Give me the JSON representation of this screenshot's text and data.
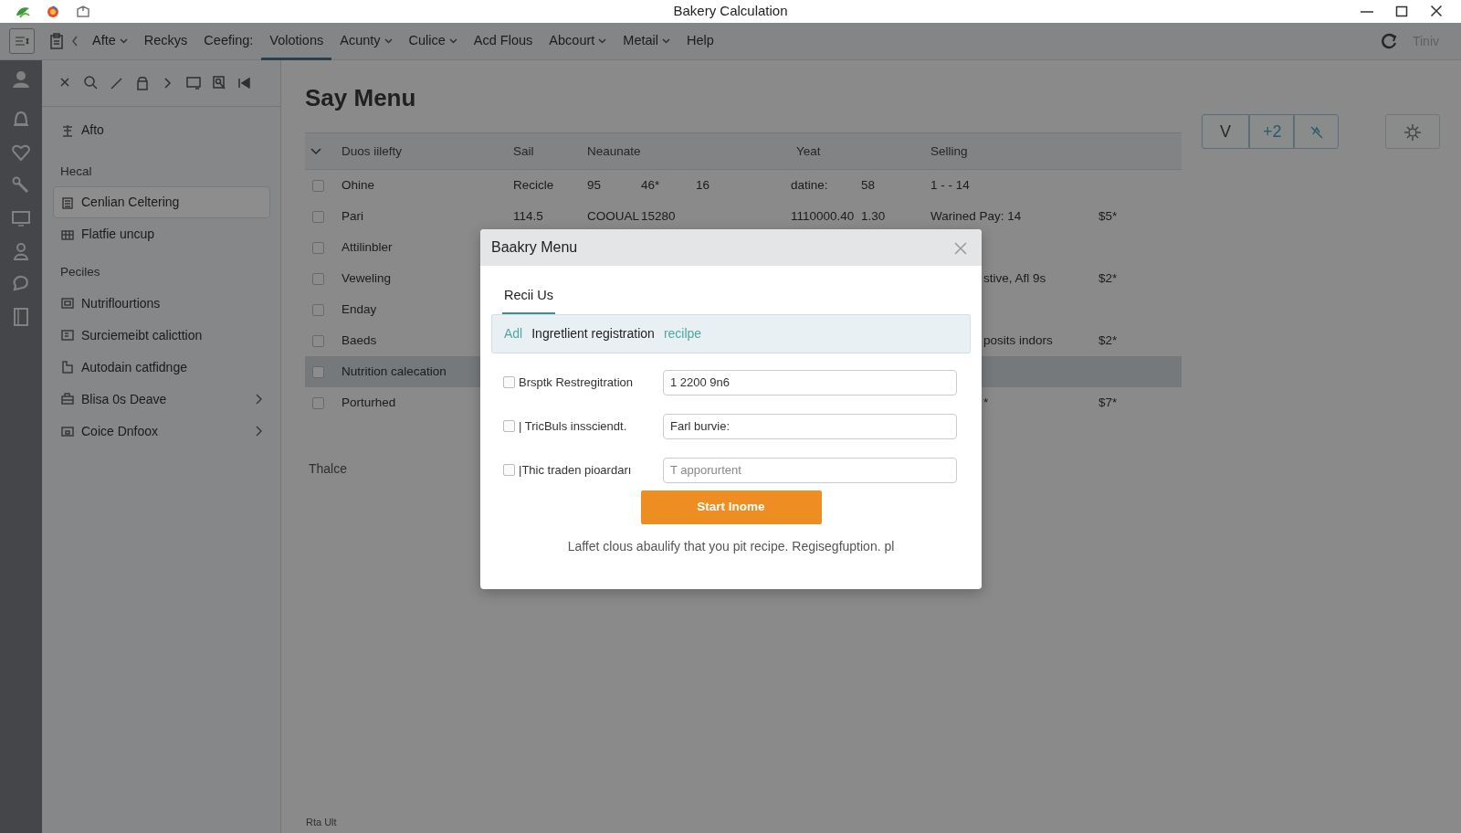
{
  "window": {
    "title": "Bakery Calculation"
  },
  "menu": {
    "items": [
      {
        "label": "Afte",
        "dropdown": true,
        "selected": false
      },
      {
        "label": "Reckys",
        "dropdown": false,
        "selected": false
      },
      {
        "label": "Ceefing:",
        "dropdown": false,
        "selected": false
      },
      {
        "label": "Volotions",
        "dropdown": false,
        "selected": true
      },
      {
        "label": "Acunty",
        "dropdown": true,
        "selected": false
      },
      {
        "label": "Culice",
        "dropdown": true,
        "selected": false
      },
      {
        "label": "Acd Flous",
        "dropdown": false,
        "selected": false
      },
      {
        "label": "Abcourt",
        "dropdown": true,
        "selected": false
      },
      {
        "label": "Metail",
        "dropdown": true,
        "selected": false
      },
      {
        "label": "Help",
        "dropdown": false,
        "selected": false
      }
    ],
    "user": "Tiniv"
  },
  "sidebar": {
    "items": [
      {
        "kind": "item",
        "label": "Afto",
        "selected": false,
        "has_submenu": false
      },
      {
        "kind": "section",
        "label": "Hecal"
      },
      {
        "kind": "item",
        "label": "Cenlian Celtering",
        "selected": true,
        "has_submenu": false
      },
      {
        "kind": "item",
        "label": "Flatfie uncup",
        "selected": false,
        "has_submenu": false
      },
      {
        "kind": "section",
        "label": "Peciles"
      },
      {
        "kind": "item",
        "label": "Nutriflourtions",
        "selected": false,
        "has_submenu": false
      },
      {
        "kind": "item",
        "label": "Surciemeibt calicttion",
        "selected": false,
        "has_submenu": false
      },
      {
        "kind": "item",
        "label": "Autodain catfidnge",
        "selected": false,
        "has_submenu": false
      },
      {
        "kind": "item",
        "label": "Blisa 0s Deave",
        "selected": false,
        "has_submenu": true
      },
      {
        "kind": "item",
        "label": "Coice Dnfoox",
        "selected": false,
        "has_submenu": true
      }
    ]
  },
  "page": {
    "title": "Say Menu",
    "note": "Thalce",
    "footer": "Rta Ult"
  },
  "toolbar_buttons": [
    "V",
    "+2"
  ],
  "table": {
    "expanded": true,
    "columns": [
      "Duos iilefty",
      "Sail",
      "Neaunate",
      "Yeat",
      "Selling"
    ],
    "rows": [
      {
        "checked": false,
        "selected": false,
        "name": "Ohine",
        "sail": "Recicle",
        "neaunate": [
          "95",
          "46*",
          "16"
        ],
        "yeat": [
          "datine:",
          "58"
        ],
        "selling": "1 - - 14"
      },
      {
        "checked": false,
        "selected": false,
        "name": "Pari",
        "sail": "114.5",
        "neaunate": [
          "COOUAL",
          "15280"
        ],
        "yeat": [
          "1110000.40",
          "1.30"
        ],
        "selling": "Warined Pay: 14",
        "column_6": "$5*"
      },
      {
        "checked": false,
        "selected": false,
        "name": "Attilinbler"
      },
      {
        "checked": false,
        "selected": false,
        "name": "Veweling",
        "selling": "stive, Afl 9s",
        "cut_left": true,
        "column_6": "$2*"
      },
      {
        "checked": false,
        "selected": false,
        "name": "Enday"
      },
      {
        "checked": false,
        "selected": false,
        "name": "Baeds",
        "selling": "posits indors",
        "cut_left": true,
        "column_6": "$2*"
      },
      {
        "checked": false,
        "selected": true,
        "name": "Nutrition calecation"
      },
      {
        "checked": false,
        "selected": false,
        "name": "Porturhed",
        "selling": "*",
        "cut_left": true,
        "column_6": "$7*"
      }
    ]
  },
  "modal": {
    "title": "Baakry Menu",
    "tabs": [
      {
        "label": "Recii Us",
        "selected": true
      }
    ],
    "banner": [
      {
        "kind": "link",
        "text": "Adl"
      },
      {
        "kind": "text",
        "text": "Ingretlient registration"
      },
      {
        "kind": "link",
        "text": "recilpe"
      }
    ],
    "fields": [
      {
        "label": "Brsptk Restregitration",
        "checked": false,
        "value": "1 2200 9n6"
      },
      {
        "label": "| TricBuls inssciendt.",
        "checked": false,
        "value": "Farl burvie:"
      },
      {
        "label": "|Thic traden pioardarı",
        "checked": false,
        "placeholder": "T apporurtent"
      }
    ],
    "button": "Start Inome",
    "footnote": "Laffet clous abaulify that you pit recipe. Regisegfuption. pl"
  }
}
